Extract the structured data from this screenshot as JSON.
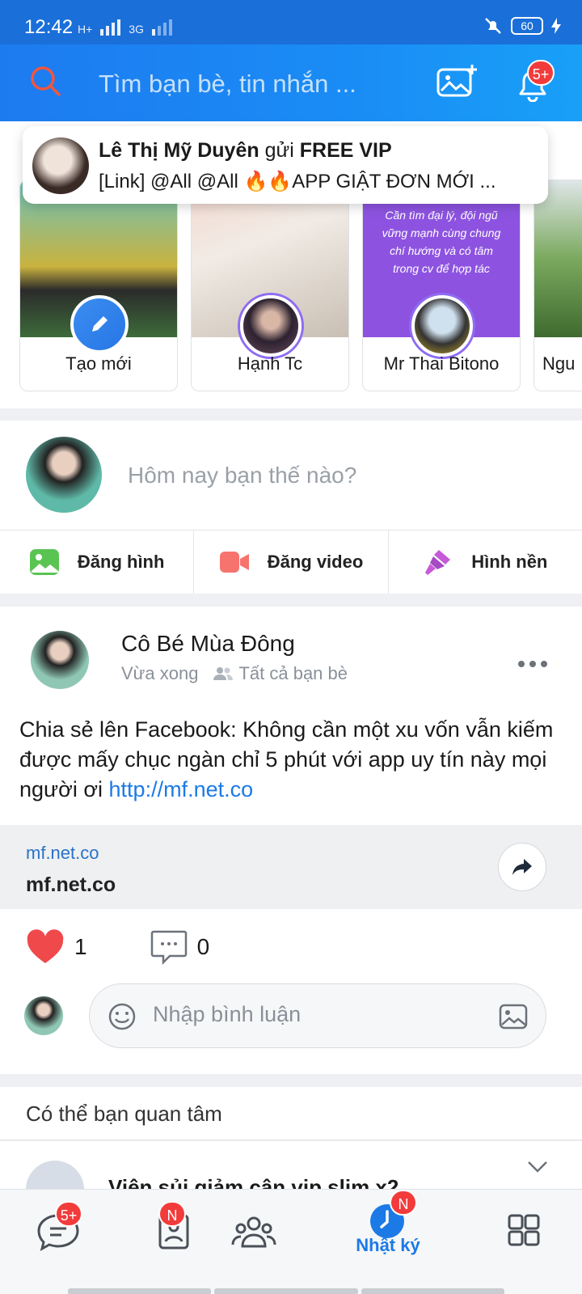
{
  "status_bar": {
    "time": "12:42",
    "network_1": "H+",
    "network_2": "3G",
    "battery": "60"
  },
  "header": {
    "search_placeholder": "Tìm bạn bè, tin nhắn ...",
    "bell_badge": "5+"
  },
  "toast": {
    "sender": "Lê Thị Mỹ Duyên",
    "verb": "gửi",
    "group": "FREE VIP",
    "message": "[Link] @All @All 🔥🔥APP GIẬT ĐƠN MỚI ..."
  },
  "stories": [
    {
      "label": "Tạo mới"
    },
    {
      "label": "Hạnh Tc"
    },
    {
      "label": "Mr Thai Bitono",
      "caption": "Cần tìm đại lý, đội ngũ vững mạnh cùng chung chí hướng và có tâm trong cv để hợp tác"
    },
    {
      "label": "Ngu"
    }
  ],
  "composer": {
    "placeholder": "Hôm nay bạn thế nào?",
    "actions": [
      "Đăng hình",
      "Đăng video",
      "Hình nền"
    ]
  },
  "post": {
    "author": "Cô Bé Mùa Đông",
    "time": "Vừa xong",
    "privacy": "Tất cả bạn bè",
    "text": "Chia sẻ lên Facebook: Không cần một xu vốn vẫn kiếm được mấy chục ngàn chỉ 5 phút với app uy tín này mọi người ơi ",
    "link": "http://mf.net.co",
    "card_domain": "mf.net.co",
    "card_title": "mf.net.co",
    "likes": "1",
    "comments": "0",
    "comment_placeholder": "Nhập bình luận"
  },
  "suggest": {
    "title": "Có thể bạn quan tâm",
    "first_item": "Viên sủi giảm cân vip slim x2"
  },
  "bottom_nav": {
    "messages_badge": "5+",
    "contacts_badge": "N",
    "timeline_badge": "N",
    "timeline_label": "Nhật ký"
  },
  "colors": {
    "accent": "#1c7ae6",
    "badge": "#f23b3b",
    "header": "#1d7bf0"
  }
}
